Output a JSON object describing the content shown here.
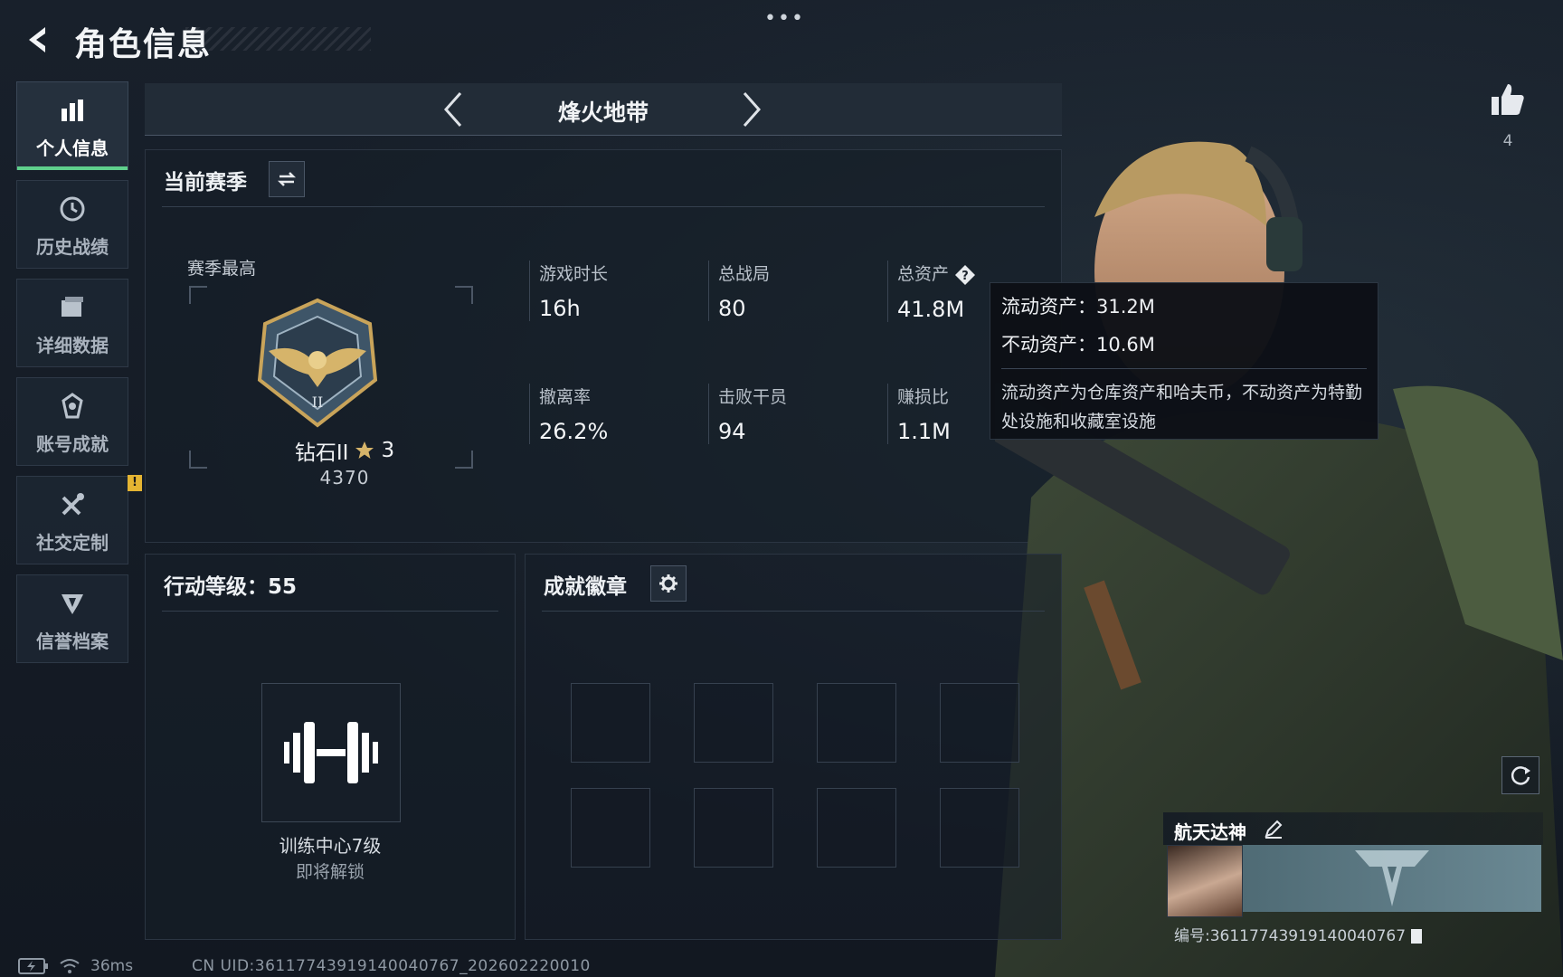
{
  "header": {
    "title": "角色信息",
    "menu": "•••"
  },
  "sidebar": {
    "items": [
      {
        "label": "个人信息",
        "icon": "bar-chart-icon",
        "active": true
      },
      {
        "label": "历史战绩",
        "icon": "clock-icon"
      },
      {
        "label": "详细数据",
        "icon": "folder-icon"
      },
      {
        "label": "账号成就",
        "icon": "medal-icon"
      },
      {
        "label": "社交定制",
        "icon": "tools-icon",
        "badge": "!"
      },
      {
        "label": "信誉档案",
        "icon": "shield-icon"
      }
    ]
  },
  "mode": {
    "name": "烽火地带"
  },
  "season": {
    "title": "当前赛季",
    "best_label": "赛季最高",
    "rank_name": "钻石II",
    "rank_stars": "3",
    "rank_score": "4370",
    "stats": [
      {
        "label": "游戏时长",
        "value": "16h"
      },
      {
        "label": "总战局",
        "value": "80"
      },
      {
        "label": "总资产",
        "value": "41.8M"
      },
      {
        "label": "撤离率",
        "value": "26.2%"
      },
      {
        "label": "击败干员",
        "value": "94"
      },
      {
        "label": "赚损比",
        "value": "1.1M"
      }
    ]
  },
  "tooltip": {
    "liquid": "流动资产：31.2M",
    "fixed": "不动资产：10.6M",
    "desc": "流动资产为仓库资产和哈夫币，不动资产为特勤处设施和收藏室设施"
  },
  "action_level": {
    "title": "行动等级：55",
    "training_name": "训练中心7级",
    "training_sub": "即将解锁"
  },
  "badges": {
    "title": "成就徽章"
  },
  "character": {
    "likes": "4",
    "player_name": "航天达神",
    "player_id": "编号:36117743919140040767"
  },
  "status": {
    "ping": "36ms",
    "uid": "CN UID:36117743919140040767_202602220010"
  },
  "colors": {
    "accent": "#5fd08c",
    "warning": "#e4b432",
    "background": "#141b25"
  }
}
